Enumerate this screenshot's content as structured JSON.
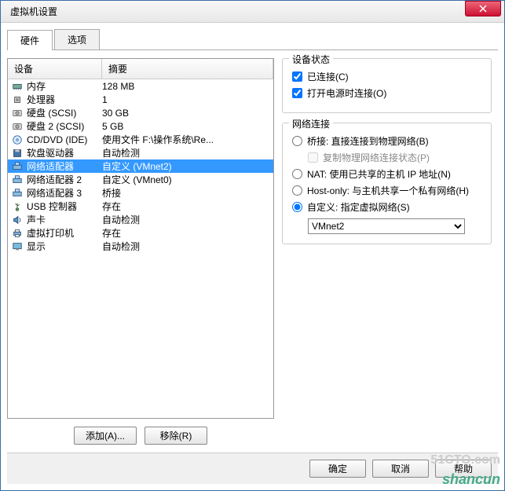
{
  "window": {
    "title": "虚拟机设置"
  },
  "tabs": {
    "hardware": "硬件",
    "options": "选项"
  },
  "list": {
    "col_device": "设备",
    "col_summary": "摘要",
    "rows": [
      {
        "icon": "memory",
        "name": "内存",
        "summary": "128 MB"
      },
      {
        "icon": "cpu",
        "name": "处理器",
        "summary": "1"
      },
      {
        "icon": "hdd",
        "name": "硬盘 (SCSI)",
        "summary": "30 GB"
      },
      {
        "icon": "hdd",
        "name": "硬盘 2 (SCSI)",
        "summary": "5 GB"
      },
      {
        "icon": "cd",
        "name": "CD/DVD (IDE)",
        "summary": "使用文件 F:\\操作系统\\Re..."
      },
      {
        "icon": "floppy",
        "name": "软盘驱动器",
        "summary": "自动检测"
      },
      {
        "icon": "nic",
        "name": "网络适配器",
        "summary": "自定义 (VMnet2)"
      },
      {
        "icon": "nic",
        "name": "网络适配器 2",
        "summary": "自定义 (VMnet0)"
      },
      {
        "icon": "nic",
        "name": "网络适配器 3",
        "summary": "桥接"
      },
      {
        "icon": "usb",
        "name": "USB 控制器",
        "summary": "存在"
      },
      {
        "icon": "sound",
        "name": "声卡",
        "summary": "自动检测"
      },
      {
        "icon": "printer",
        "name": "虚拟打印机",
        "summary": "存在"
      },
      {
        "icon": "display",
        "name": "显示",
        "summary": "自动检测"
      }
    ],
    "selected_index": 6,
    "add_btn": "添加(A)...",
    "remove_btn": "移除(R)"
  },
  "status": {
    "title": "设备状态",
    "connected": "已连接(C)",
    "connect_at_power": "打开电源时连接(O)"
  },
  "network": {
    "title": "网络连接",
    "bridged": "桥接: 直接连接到物理网络(B)",
    "replicate": "复制物理网络连接状态(P)",
    "nat": "NAT: 使用已共享的主机 IP 地址(N)",
    "hostonly": "Host-only: 与主机共享一个私有网络(H)",
    "custom": "自定义: 指定虚拟网络(S)",
    "selected_vnet": "VMnet2"
  },
  "buttons": {
    "ok": "确定",
    "cancel": "取消",
    "help": "帮助"
  },
  "watermark": {
    "a": "51CTO.com",
    "b": "shancun"
  }
}
